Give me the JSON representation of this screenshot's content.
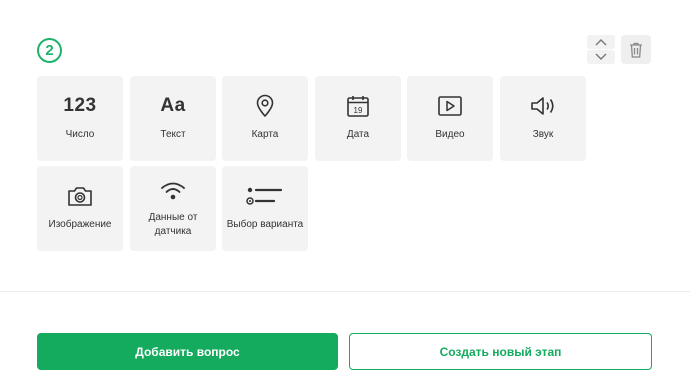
{
  "step": {
    "number": "2"
  },
  "colors": {
    "accent": "#14ab5e",
    "tile_bg": "#f3f3f3"
  },
  "controls": {
    "move_up_icon": "chevron-up-icon",
    "move_down_icon": "chevron-down-icon",
    "delete_icon": "trash-icon"
  },
  "question_types": [
    {
      "label": "Число",
      "glyph": "123",
      "icon": "number-icon"
    },
    {
      "label": "Текст",
      "glyph": "Aa",
      "icon": "text-icon"
    },
    {
      "label": "Карта",
      "icon": "map-pin-icon"
    },
    {
      "label": "Дата",
      "glyph": "19",
      "icon": "calendar-icon"
    },
    {
      "label": "Видео",
      "icon": "video-icon"
    },
    {
      "label": "Звук",
      "icon": "sound-icon"
    },
    {
      "label": "Изображение",
      "icon": "camera-icon"
    },
    {
      "label": "Данные от датчика",
      "icon": "sensor-icon"
    },
    {
      "label": "Выбор варианта",
      "icon": "choice-list-icon"
    }
  ],
  "actions": {
    "add_question": "Добавить вопрос",
    "create_stage": "Создать новый этап"
  }
}
